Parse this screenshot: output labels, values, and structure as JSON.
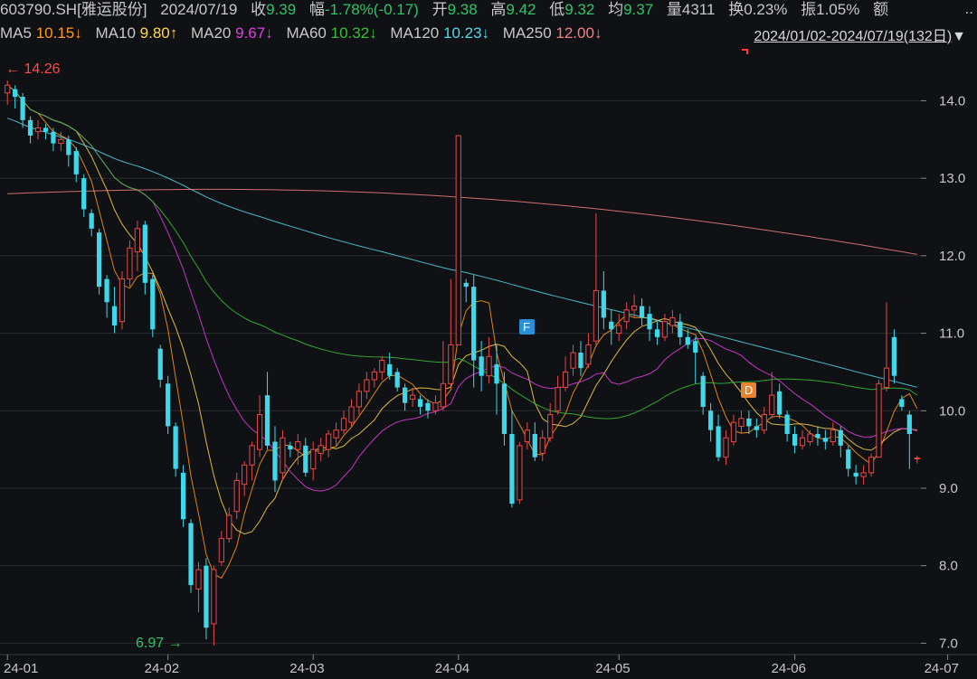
{
  "header": {
    "code": "603790.SH[雅运股份]",
    "date": "2024/07/19",
    "close_label": "收",
    "close": "9.39",
    "change_label": "幅",
    "change": "-1.78%(-0.17)",
    "open_label": "开",
    "open": "9.38",
    "high_label": "高",
    "high": "9.42",
    "low_label": "低",
    "low": "9.32",
    "avg_label": "均",
    "avg": "9.37",
    "vol_label": "量",
    "vol": "4311",
    "turnover_label": "换",
    "turnover": "0.23%",
    "amplitude_label": "振",
    "amplitude": "1.05%",
    "amount_label": "额",
    "more": ".."
  },
  "ma_bar": {
    "items": [
      {
        "label": "MA5",
        "value": "10.15",
        "arrow": "↓",
        "color": "#ff9a1f"
      },
      {
        "label": "MA10",
        "value": "9.80",
        "arrow": "↑",
        "color": "#ffd84a"
      },
      {
        "label": "MA20",
        "value": "9.67",
        "arrow": "↓",
        "color": "#e040e0"
      },
      {
        "label": "MA60",
        "value": "10.32",
        "arrow": "↓",
        "color": "#38c038"
      },
      {
        "label": "MA120",
        "value": "10.23",
        "arrow": "↓",
        "color": "#55d8e8"
      },
      {
        "label": "MA250",
        "value": "12.00",
        "arrow": "↓",
        "color": "#f08080"
      }
    ],
    "range": "2024/01/02-2024/07/19(132日)",
    "range_arrow": "▼"
  },
  "colors": {
    "up": "#e84848",
    "down": "#3ed8ea",
    "background": "#101114",
    "grid": "#2a2c30"
  },
  "markers": {
    "high_label": "14.26",
    "low_label": "6.97",
    "f_badge": "F",
    "d_badge": "D"
  },
  "chart_data": {
    "type": "candlestick",
    "y_ticks": [
      "14.0",
      "13.0",
      "12.0",
      "11.0",
      "10.0",
      "9.0",
      "8.0",
      "7.0"
    ],
    "ylim": [
      6.9,
      14.6
    ],
    "x_ticks": [
      "24-01",
      "24-02",
      "24-03",
      "24-04",
      "24-05",
      "24-06",
      "24-07"
    ],
    "candles": [
      [
        14.1,
        14.2,
        13.95,
        14.26
      ],
      [
        14.15,
        14.05,
        13.9,
        14.2
      ],
      [
        14.05,
        13.75,
        13.65,
        14.1
      ],
      [
        13.75,
        13.55,
        13.45,
        13.8
      ],
      [
        13.6,
        13.65,
        13.5,
        13.75
      ],
      [
        13.65,
        13.6,
        13.5,
        13.7
      ],
      [
        13.6,
        13.45,
        13.35,
        13.65
      ],
      [
        13.45,
        13.5,
        13.35,
        13.6
      ],
      [
        13.5,
        13.3,
        13.15,
        13.55
      ],
      [
        13.35,
        13.05,
        12.95,
        13.4
      ],
      [
        13.0,
        12.6,
        12.5,
        13.05
      ],
      [
        12.55,
        12.35,
        12.25,
        12.6
      ],
      [
        12.3,
        11.6,
        11.5,
        12.35
      ],
      [
        11.7,
        11.4,
        11.2,
        11.75
      ],
      [
        11.35,
        11.1,
        11.0,
        11.6
      ],
      [
        11.15,
        11.7,
        11.05,
        11.8
      ],
      [
        11.7,
        12.1,
        11.6,
        12.2
      ],
      [
        12.05,
        12.35,
        11.8,
        12.45
      ],
      [
        12.4,
        11.65,
        11.5,
        12.45
      ],
      [
        11.7,
        11.05,
        10.95,
        11.75
      ],
      [
        10.8,
        10.4,
        10.3,
        10.85
      ],
      [
        10.35,
        9.8,
        9.7,
        10.45
      ],
      [
        9.8,
        9.25,
        9.15,
        9.85
      ],
      [
        9.2,
        8.6,
        8.5,
        9.3
      ],
      [
        8.55,
        7.75,
        7.65,
        8.6
      ],
      [
        7.7,
        7.95,
        7.4,
        8.05
      ],
      [
        8.0,
        7.2,
        7.05,
        8.1
      ],
      [
        7.25,
        7.95,
        6.97,
        8.0
      ],
      [
        8.05,
        8.35,
        8.0,
        8.45
      ],
      [
        8.35,
        8.65,
        8.3,
        8.75
      ],
      [
        8.7,
        9.1,
        8.6,
        9.2
      ],
      [
        9.05,
        9.3,
        8.9,
        9.35
      ],
      [
        9.3,
        9.55,
        9.1,
        9.6
      ],
      [
        9.5,
        9.95,
        9.4,
        10.2
      ],
      [
        10.2,
        9.55,
        9.5,
        10.5
      ],
      [
        9.6,
        9.1,
        8.95,
        9.8
      ],
      [
        9.2,
        9.65,
        9.1,
        9.75
      ],
      [
        9.55,
        9.5,
        9.4,
        9.6
      ],
      [
        9.5,
        9.6,
        9.3,
        9.7
      ],
      [
        9.55,
        9.2,
        9.15,
        9.65
      ],
      [
        9.25,
        9.5,
        9.1,
        9.6
      ],
      [
        9.45,
        9.55,
        9.35,
        9.65
      ],
      [
        9.5,
        9.7,
        9.4,
        9.75
      ],
      [
        9.65,
        9.75,
        9.55,
        9.85
      ],
      [
        9.75,
        9.9,
        9.7,
        10.0
      ],
      [
        9.85,
        10.05,
        9.8,
        10.15
      ],
      [
        10.05,
        10.25,
        9.95,
        10.35
      ],
      [
        10.25,
        10.4,
        10.15,
        10.5
      ],
      [
        10.4,
        10.5,
        10.3,
        10.55
      ],
      [
        10.5,
        10.65,
        10.4,
        10.7
      ],
      [
        10.6,
        10.45,
        10.4,
        10.75
      ],
      [
        10.5,
        10.3,
        10.25,
        10.55
      ],
      [
        10.3,
        10.1,
        10.0,
        10.35
      ],
      [
        10.15,
        10.2,
        10.05,
        10.3
      ],
      [
        10.15,
        10.05,
        9.95,
        10.2
      ],
      [
        10.1,
        10.0,
        9.9,
        10.15
      ],
      [
        10.0,
        10.1,
        9.95,
        10.2
      ],
      [
        10.05,
        10.35,
        10.0,
        10.9
      ],
      [
        10.35,
        10.85,
        10.3,
        11.7
      ],
      [
        10.85,
        13.55,
        12.3,
        11.2
      ],
      [
        11.65,
        11.6,
        11.4,
        11.7
      ],
      [
        11.6,
        10.65,
        10.3,
        11.75
      ],
      [
        10.7,
        10.45,
        10.25,
        10.9
      ],
      [
        10.45,
        10.7,
        10.35,
        10.95
      ],
      [
        10.6,
        10.35,
        9.95,
        10.85
      ],
      [
        10.35,
        9.7,
        9.55,
        10.5
      ],
      [
        9.7,
        8.8,
        8.75,
        10.0
      ],
      [
        8.85,
        9.55,
        8.8,
        9.6
      ],
      [
        9.6,
        9.75,
        9.5,
        9.85
      ],
      [
        9.7,
        9.4,
        9.35,
        9.85
      ],
      [
        9.45,
        9.65,
        9.35,
        9.75
      ],
      [
        9.65,
        9.95,
        9.6,
        10.1
      ],
      [
        10.0,
        10.3,
        9.95,
        10.45
      ],
      [
        10.3,
        10.5,
        10.25,
        10.7
      ],
      [
        10.55,
        10.75,
        10.45,
        10.85
      ],
      [
        10.75,
        10.55,
        10.45,
        10.9
      ],
      [
        10.6,
        10.85,
        10.55,
        11.0
      ],
      [
        10.9,
        11.55,
        10.85,
        12.55
      ],
      [
        11.55,
        11.2,
        11.05,
        11.8
      ],
      [
        11.15,
        11.05,
        10.85,
        11.3
      ],
      [
        11.0,
        11.1,
        10.9,
        11.25
      ],
      [
        11.15,
        11.3,
        11.05,
        11.4
      ],
      [
        11.3,
        11.35,
        11.2,
        11.5
      ],
      [
        11.35,
        11.2,
        11.1,
        11.45
      ],
      [
        11.25,
        11.05,
        10.9,
        11.35
      ],
      [
        11.05,
        10.95,
        10.85,
        11.15
      ],
      [
        10.95,
        11.15,
        10.9,
        11.25
      ],
      [
        11.1,
        11.2,
        11.0,
        11.3
      ],
      [
        11.15,
        10.95,
        10.85,
        11.25
      ],
      [
        10.95,
        10.85,
        10.8,
        11.05
      ],
      [
        10.9,
        10.75,
        10.35,
        10.95
      ],
      [
        10.45,
        10.05,
        9.95,
        10.5
      ],
      [
        10.0,
        9.75,
        9.6,
        10.1
      ],
      [
        9.8,
        9.4,
        9.35,
        9.95
      ],
      [
        9.4,
        9.65,
        9.3,
        9.75
      ],
      [
        9.6,
        9.85,
        9.55,
        9.95
      ],
      [
        9.8,
        9.9,
        9.7,
        10.0
      ],
      [
        9.9,
        9.8,
        9.7,
        10.0
      ],
      [
        9.8,
        9.75,
        9.65,
        9.9
      ],
      [
        9.75,
        9.95,
        9.7,
        10.05
      ],
      [
        9.95,
        10.2,
        9.9,
        10.5
      ],
      [
        10.25,
        9.95,
        9.9,
        10.35
      ],
      [
        9.95,
        9.7,
        9.6,
        10.0
      ],
      [
        9.7,
        9.55,
        9.45,
        9.8
      ],
      [
        9.55,
        9.65,
        9.5,
        9.75
      ],
      [
        9.6,
        9.7,
        9.55,
        9.75
      ],
      [
        9.7,
        9.65,
        9.55,
        9.8
      ],
      [
        9.65,
        9.6,
        9.5,
        9.75
      ],
      [
        9.6,
        9.75,
        9.55,
        9.85
      ],
      [
        9.75,
        9.55,
        9.4,
        9.8
      ],
      [
        9.5,
        9.25,
        9.15,
        9.55
      ],
      [
        9.2,
        9.15,
        9.05,
        9.3
      ],
      [
        9.15,
        9.2,
        9.05,
        9.3
      ],
      [
        9.2,
        9.4,
        9.15,
        9.45
      ],
      [
        9.4,
        10.35,
        9.4,
        10.4
      ],
      [
        10.3,
        10.55,
        10.25,
        11.4
      ],
      [
        10.95,
        10.45,
        10.35,
        11.05
      ],
      [
        10.15,
        10.05,
        10.0,
        10.2
      ],
      [
        9.95,
        9.7,
        9.25,
        10.0
      ],
      [
        9.38,
        9.39,
        9.32,
        9.42
      ]
    ]
  }
}
